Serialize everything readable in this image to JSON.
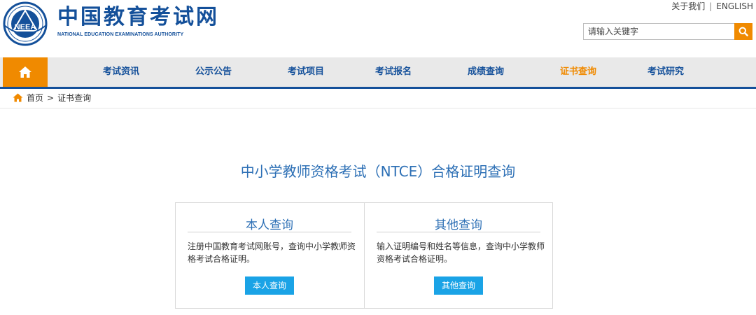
{
  "top_links": {
    "about": "关于我们",
    "separator": "|",
    "english": "ENGLISH"
  },
  "brand": {
    "name_cn": "中国教育考试网",
    "name_en": "NATIONAL EDUCATION EXAMINATIONS AUTHORITY",
    "logo_text": "NEEA"
  },
  "search": {
    "placeholder": "请输入关键字",
    "button_icon": "search-icon"
  },
  "nav": {
    "home_icon": "home-icon",
    "items": [
      {
        "label": "考试资讯",
        "active": false
      },
      {
        "label": "公示公告",
        "active": false
      },
      {
        "label": "考试项目",
        "active": false
      },
      {
        "label": "考试报名",
        "active": false
      },
      {
        "label": "成绩查询",
        "active": false
      },
      {
        "label": "证书查询",
        "active": true
      },
      {
        "label": "考试研究",
        "active": false
      }
    ]
  },
  "breadcrumb": {
    "home": "首页",
    "separator": ">",
    "current": "证书查询"
  },
  "page_title": "中小学教师资格考试（NTCE）合格证明查询",
  "cards": [
    {
      "title": "本人查询",
      "description": "注册中国教育考试网账号，查询中小学教师资格考试合格证明。",
      "button": "本人查询"
    },
    {
      "title": "其他查询",
      "description": "输入证明编号和姓名等信息，查询中小学教师资格考试合格证明。",
      "button": "其他查询"
    }
  ],
  "colors": {
    "brand_blue": "#14509a",
    "accent_orange": "#f08a00",
    "title_blue": "#2c6fb5",
    "button_blue": "#1aa3e6"
  }
}
